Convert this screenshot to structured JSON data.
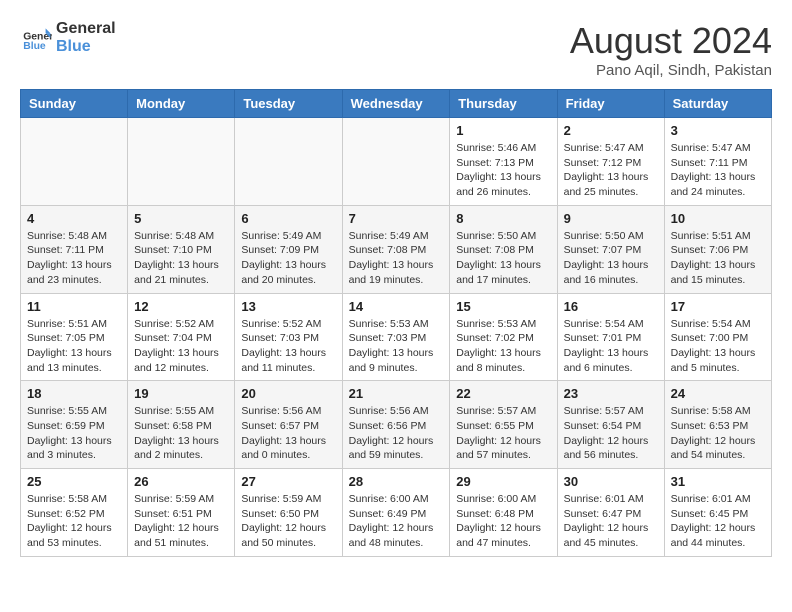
{
  "logo": {
    "line1": "General",
    "line2": "Blue",
    "icon": "🔵"
  },
  "title": "August 2024",
  "location": "Pano Aqil, Sindh, Pakistan",
  "days_of_week": [
    "Sunday",
    "Monday",
    "Tuesday",
    "Wednesday",
    "Thursday",
    "Friday",
    "Saturday"
  ],
  "weeks": [
    [
      {
        "day": "",
        "info": ""
      },
      {
        "day": "",
        "info": ""
      },
      {
        "day": "",
        "info": ""
      },
      {
        "day": "",
        "info": ""
      },
      {
        "day": "1",
        "info": "Sunrise: 5:46 AM\nSunset: 7:13 PM\nDaylight: 13 hours\nand 26 minutes."
      },
      {
        "day": "2",
        "info": "Sunrise: 5:47 AM\nSunset: 7:12 PM\nDaylight: 13 hours\nand 25 minutes."
      },
      {
        "day": "3",
        "info": "Sunrise: 5:47 AM\nSunset: 7:11 PM\nDaylight: 13 hours\nand 24 minutes."
      }
    ],
    [
      {
        "day": "4",
        "info": "Sunrise: 5:48 AM\nSunset: 7:11 PM\nDaylight: 13 hours\nand 23 minutes."
      },
      {
        "day": "5",
        "info": "Sunrise: 5:48 AM\nSunset: 7:10 PM\nDaylight: 13 hours\nand 21 minutes."
      },
      {
        "day": "6",
        "info": "Sunrise: 5:49 AM\nSunset: 7:09 PM\nDaylight: 13 hours\nand 20 minutes."
      },
      {
        "day": "7",
        "info": "Sunrise: 5:49 AM\nSunset: 7:08 PM\nDaylight: 13 hours\nand 19 minutes."
      },
      {
        "day": "8",
        "info": "Sunrise: 5:50 AM\nSunset: 7:08 PM\nDaylight: 13 hours\nand 17 minutes."
      },
      {
        "day": "9",
        "info": "Sunrise: 5:50 AM\nSunset: 7:07 PM\nDaylight: 13 hours\nand 16 minutes."
      },
      {
        "day": "10",
        "info": "Sunrise: 5:51 AM\nSunset: 7:06 PM\nDaylight: 13 hours\nand 15 minutes."
      }
    ],
    [
      {
        "day": "11",
        "info": "Sunrise: 5:51 AM\nSunset: 7:05 PM\nDaylight: 13 hours\nand 13 minutes."
      },
      {
        "day": "12",
        "info": "Sunrise: 5:52 AM\nSunset: 7:04 PM\nDaylight: 13 hours\nand 12 minutes."
      },
      {
        "day": "13",
        "info": "Sunrise: 5:52 AM\nSunset: 7:03 PM\nDaylight: 13 hours\nand 11 minutes."
      },
      {
        "day": "14",
        "info": "Sunrise: 5:53 AM\nSunset: 7:03 PM\nDaylight: 13 hours\nand 9 minutes."
      },
      {
        "day": "15",
        "info": "Sunrise: 5:53 AM\nSunset: 7:02 PM\nDaylight: 13 hours\nand 8 minutes."
      },
      {
        "day": "16",
        "info": "Sunrise: 5:54 AM\nSunset: 7:01 PM\nDaylight: 13 hours\nand 6 minutes."
      },
      {
        "day": "17",
        "info": "Sunrise: 5:54 AM\nSunset: 7:00 PM\nDaylight: 13 hours\nand 5 minutes."
      }
    ],
    [
      {
        "day": "18",
        "info": "Sunrise: 5:55 AM\nSunset: 6:59 PM\nDaylight: 13 hours\nand 3 minutes."
      },
      {
        "day": "19",
        "info": "Sunrise: 5:55 AM\nSunset: 6:58 PM\nDaylight: 13 hours\nand 2 minutes."
      },
      {
        "day": "20",
        "info": "Sunrise: 5:56 AM\nSunset: 6:57 PM\nDaylight: 13 hours\nand 0 minutes."
      },
      {
        "day": "21",
        "info": "Sunrise: 5:56 AM\nSunset: 6:56 PM\nDaylight: 12 hours\nand 59 minutes."
      },
      {
        "day": "22",
        "info": "Sunrise: 5:57 AM\nSunset: 6:55 PM\nDaylight: 12 hours\nand 57 minutes."
      },
      {
        "day": "23",
        "info": "Sunrise: 5:57 AM\nSunset: 6:54 PM\nDaylight: 12 hours\nand 56 minutes."
      },
      {
        "day": "24",
        "info": "Sunrise: 5:58 AM\nSunset: 6:53 PM\nDaylight: 12 hours\nand 54 minutes."
      }
    ],
    [
      {
        "day": "25",
        "info": "Sunrise: 5:58 AM\nSunset: 6:52 PM\nDaylight: 12 hours\nand 53 minutes."
      },
      {
        "day": "26",
        "info": "Sunrise: 5:59 AM\nSunset: 6:51 PM\nDaylight: 12 hours\nand 51 minutes."
      },
      {
        "day": "27",
        "info": "Sunrise: 5:59 AM\nSunset: 6:50 PM\nDaylight: 12 hours\nand 50 minutes."
      },
      {
        "day": "28",
        "info": "Sunrise: 6:00 AM\nSunset: 6:49 PM\nDaylight: 12 hours\nand 48 minutes."
      },
      {
        "day": "29",
        "info": "Sunrise: 6:00 AM\nSunset: 6:48 PM\nDaylight: 12 hours\nand 47 minutes."
      },
      {
        "day": "30",
        "info": "Sunrise: 6:01 AM\nSunset: 6:47 PM\nDaylight: 12 hours\nand 45 minutes."
      },
      {
        "day": "31",
        "info": "Sunrise: 6:01 AM\nSunset: 6:45 PM\nDaylight: 12 hours\nand 44 minutes."
      }
    ]
  ]
}
